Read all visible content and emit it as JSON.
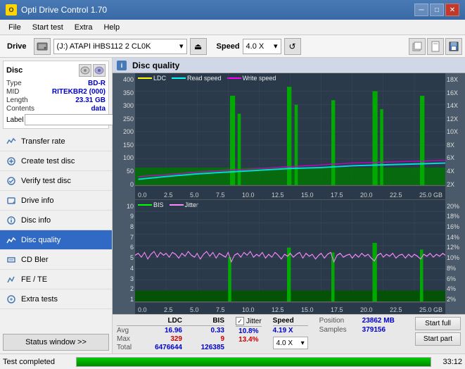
{
  "titlebar": {
    "title": "Opti Drive Control 1.70",
    "icon_label": "O",
    "btn_minimize": "─",
    "btn_maximize": "□",
    "btn_close": "✕"
  },
  "menubar": {
    "items": [
      {
        "label": "File"
      },
      {
        "label": "Start test"
      },
      {
        "label": "Extra"
      },
      {
        "label": "Help"
      }
    ]
  },
  "toolbar": {
    "drive_label": "Drive",
    "drive_value": "(J:)  ATAPI iHBS112  2 CL0K",
    "speed_label": "Speed",
    "speed_value": "4.0 X",
    "dropdown_arrow": "▾",
    "eject_icon": "⏏"
  },
  "disc_panel": {
    "title": "Disc",
    "fields": [
      {
        "label": "Type",
        "value": "BD-R"
      },
      {
        "label": "MID",
        "value": "RITEKBR2 (000)"
      },
      {
        "label": "Length",
        "value": "23.31 GB"
      },
      {
        "label": "Contents",
        "value": "data"
      },
      {
        "label": "Label",
        "value": ""
      }
    ]
  },
  "nav_items": [
    {
      "label": "Transfer rate",
      "active": false
    },
    {
      "label": "Create test disc",
      "active": false
    },
    {
      "label": "Verify test disc",
      "active": false
    },
    {
      "label": "Drive info",
      "active": false
    },
    {
      "label": "Disc info",
      "active": false
    },
    {
      "label": "Disc quality",
      "active": true
    },
    {
      "label": "CD Bler",
      "active": false
    },
    {
      "label": "FE / TE",
      "active": false
    },
    {
      "label": "Extra tests",
      "active": false
    }
  ],
  "status_window_btn": "Status window >>",
  "chart_header": {
    "title": "Disc quality",
    "icon": "i"
  },
  "chart1": {
    "title": "Disc quality",
    "legend": [
      {
        "label": "LDC",
        "color": "#ffff00"
      },
      {
        "label": "Read speed",
        "color": "#00ffff"
      },
      {
        "label": "Write speed",
        "color": "#ff00ff"
      }
    ],
    "y_left": [
      "400",
      "350",
      "300",
      "250",
      "200",
      "150",
      "100",
      "50",
      "0"
    ],
    "y_right": [
      "18X",
      "16X",
      "14X",
      "12X",
      "10X",
      "8X",
      "6X",
      "4X",
      "2X"
    ],
    "x_labels": [
      "0.0",
      "2.5",
      "5.0",
      "7.5",
      "10.0",
      "12.5",
      "15.0",
      "17.5",
      "20.0",
      "22.5",
      "25.0 GB"
    ]
  },
  "chart2": {
    "legend": [
      {
        "label": "BIS",
        "color": "#00ff00"
      },
      {
        "label": "Jitter",
        "color": "#ff88ff"
      }
    ],
    "y_left": [
      "10",
      "9",
      "8",
      "7",
      "6",
      "5",
      "4",
      "3",
      "2",
      "1"
    ],
    "y_right": [
      "20%",
      "18%",
      "16%",
      "14%",
      "12%",
      "10%",
      "8%",
      "6%",
      "4%",
      "2%"
    ],
    "x_labels": [
      "0.0",
      "2.5",
      "5.0",
      "7.5",
      "10.0",
      "12.5",
      "15.0",
      "17.5",
      "20.0",
      "22.5",
      "25.0 GB"
    ]
  },
  "stats": {
    "columns": [
      "LDC",
      "BIS"
    ],
    "jitter_label": "Jitter",
    "jitter_checked": true,
    "speed_label": "Speed",
    "speed_value": "4.19 X",
    "speed_combo": "4.0 X",
    "avg_label": "Avg",
    "avg_ldc": "16.96",
    "avg_bis": "0.33",
    "avg_jitter": "10.8%",
    "max_label": "Max",
    "max_ldc": "329",
    "max_bis": "9",
    "max_jitter": "13.4%",
    "total_label": "Total",
    "total_ldc": "6476644",
    "total_bis": "126385",
    "position_label": "Position",
    "position_value": "23862 MB",
    "samples_label": "Samples",
    "samples_value": "379156",
    "start_full_btn": "Start full",
    "start_part_btn": "Start part"
  },
  "statusbar": {
    "text": "Test completed",
    "progress": 100,
    "time": "33:12"
  }
}
